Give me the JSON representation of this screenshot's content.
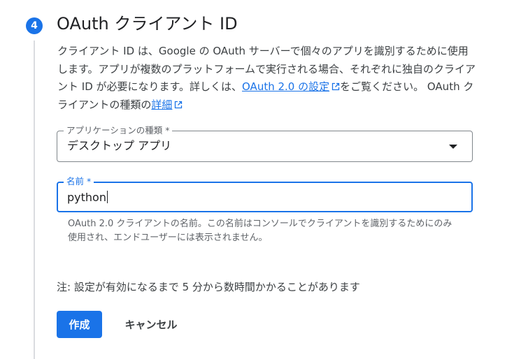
{
  "step": {
    "number": "4",
    "title": "OAuth クライアント ID"
  },
  "description": {
    "text_before_link": "クライアント ID は、Google の OAuth サーバーで個々のアプリを識別するために使用します。アプリが複数のプラットフォームで実行される場合、それぞれに独自のクライアント ID が必要になります。詳しくは、",
    "link1_label": "OAuth 2.0 の設定",
    "text_middle": "をご覧ください。 OAuth クライアントの種類の",
    "link2_label": "詳細"
  },
  "app_type_field": {
    "label": "アプリケーションの種類 *",
    "value": "デスクトップ アプリ"
  },
  "name_field": {
    "label": "名前 *",
    "value": "python",
    "helper": "OAuth 2.0 クライアントの名前。この名前はコンソールでクライアントを識別するためにのみ使用され、エンドユーザーには表示されません。"
  },
  "note": "注: 設定が有効になるまで 5 分から数時間かかることがあります",
  "actions": {
    "create_label": "作成",
    "cancel_label": "キャンセル"
  },
  "colors": {
    "accent": "#1a73e8",
    "text_primary": "#202124",
    "text_secondary": "#5f6368"
  },
  "icons": {
    "external_link": "open-in-new-icon",
    "dropdown": "arrow-drop-down-icon"
  }
}
